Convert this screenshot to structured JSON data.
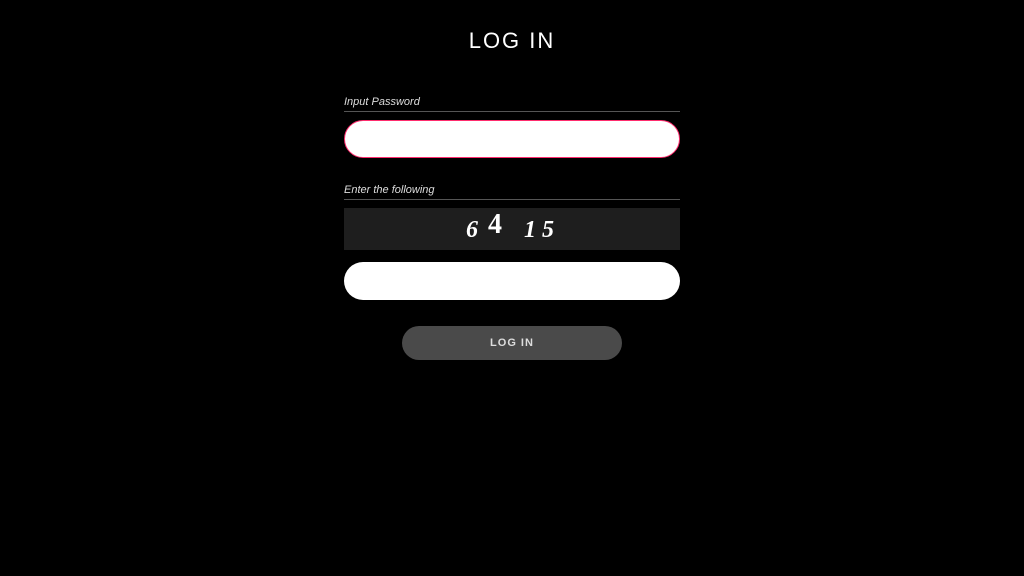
{
  "page": {
    "title": "LOG IN"
  },
  "password_section": {
    "label": "Input Password",
    "value": ""
  },
  "captcha_section": {
    "label": "Enter the following",
    "digits": [
      "6",
      "4",
      "1",
      "5"
    ],
    "input_value": ""
  },
  "submit": {
    "label": "LOG IN"
  }
}
